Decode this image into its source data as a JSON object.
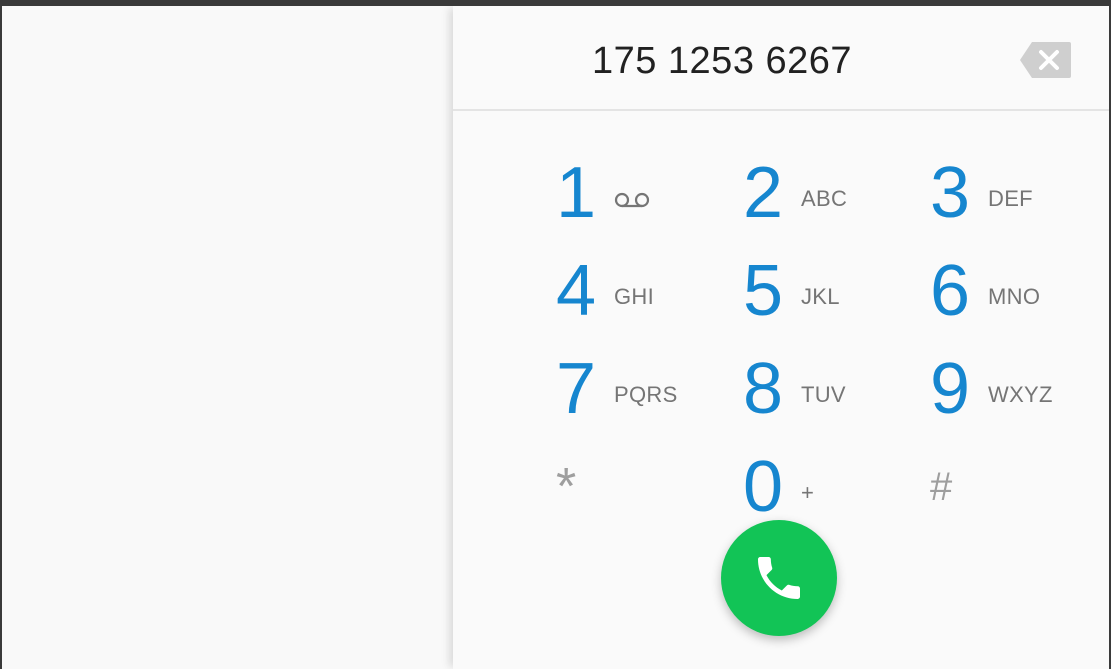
{
  "dialer": {
    "phone_number": "175 1253 6267",
    "icons": {
      "backspace": "backspace-icon",
      "voicemail": "voicemail-icon",
      "call": "phone-icon"
    },
    "keys": [
      {
        "digit": "1",
        "letters": ""
      },
      {
        "digit": "2",
        "letters": "ABC"
      },
      {
        "digit": "3",
        "letters": "DEF"
      },
      {
        "digit": "4",
        "letters": "GHI"
      },
      {
        "digit": "5",
        "letters": "JKL"
      },
      {
        "digit": "6",
        "letters": "MNO"
      },
      {
        "digit": "7",
        "letters": "PQRS"
      },
      {
        "digit": "8",
        "letters": "TUV"
      },
      {
        "digit": "9",
        "letters": "WXYZ"
      },
      {
        "digit": "*",
        "letters": ""
      },
      {
        "digit": "0",
        "letters": "+"
      },
      {
        "digit": "#",
        "letters": ""
      }
    ]
  },
  "colors": {
    "digit_blue": "#1686cf",
    "call_green": "#12c456",
    "letters_gray": "#757575",
    "symbol_gray": "#9e9e9e",
    "backspace_gray": "#cfcfcf"
  }
}
